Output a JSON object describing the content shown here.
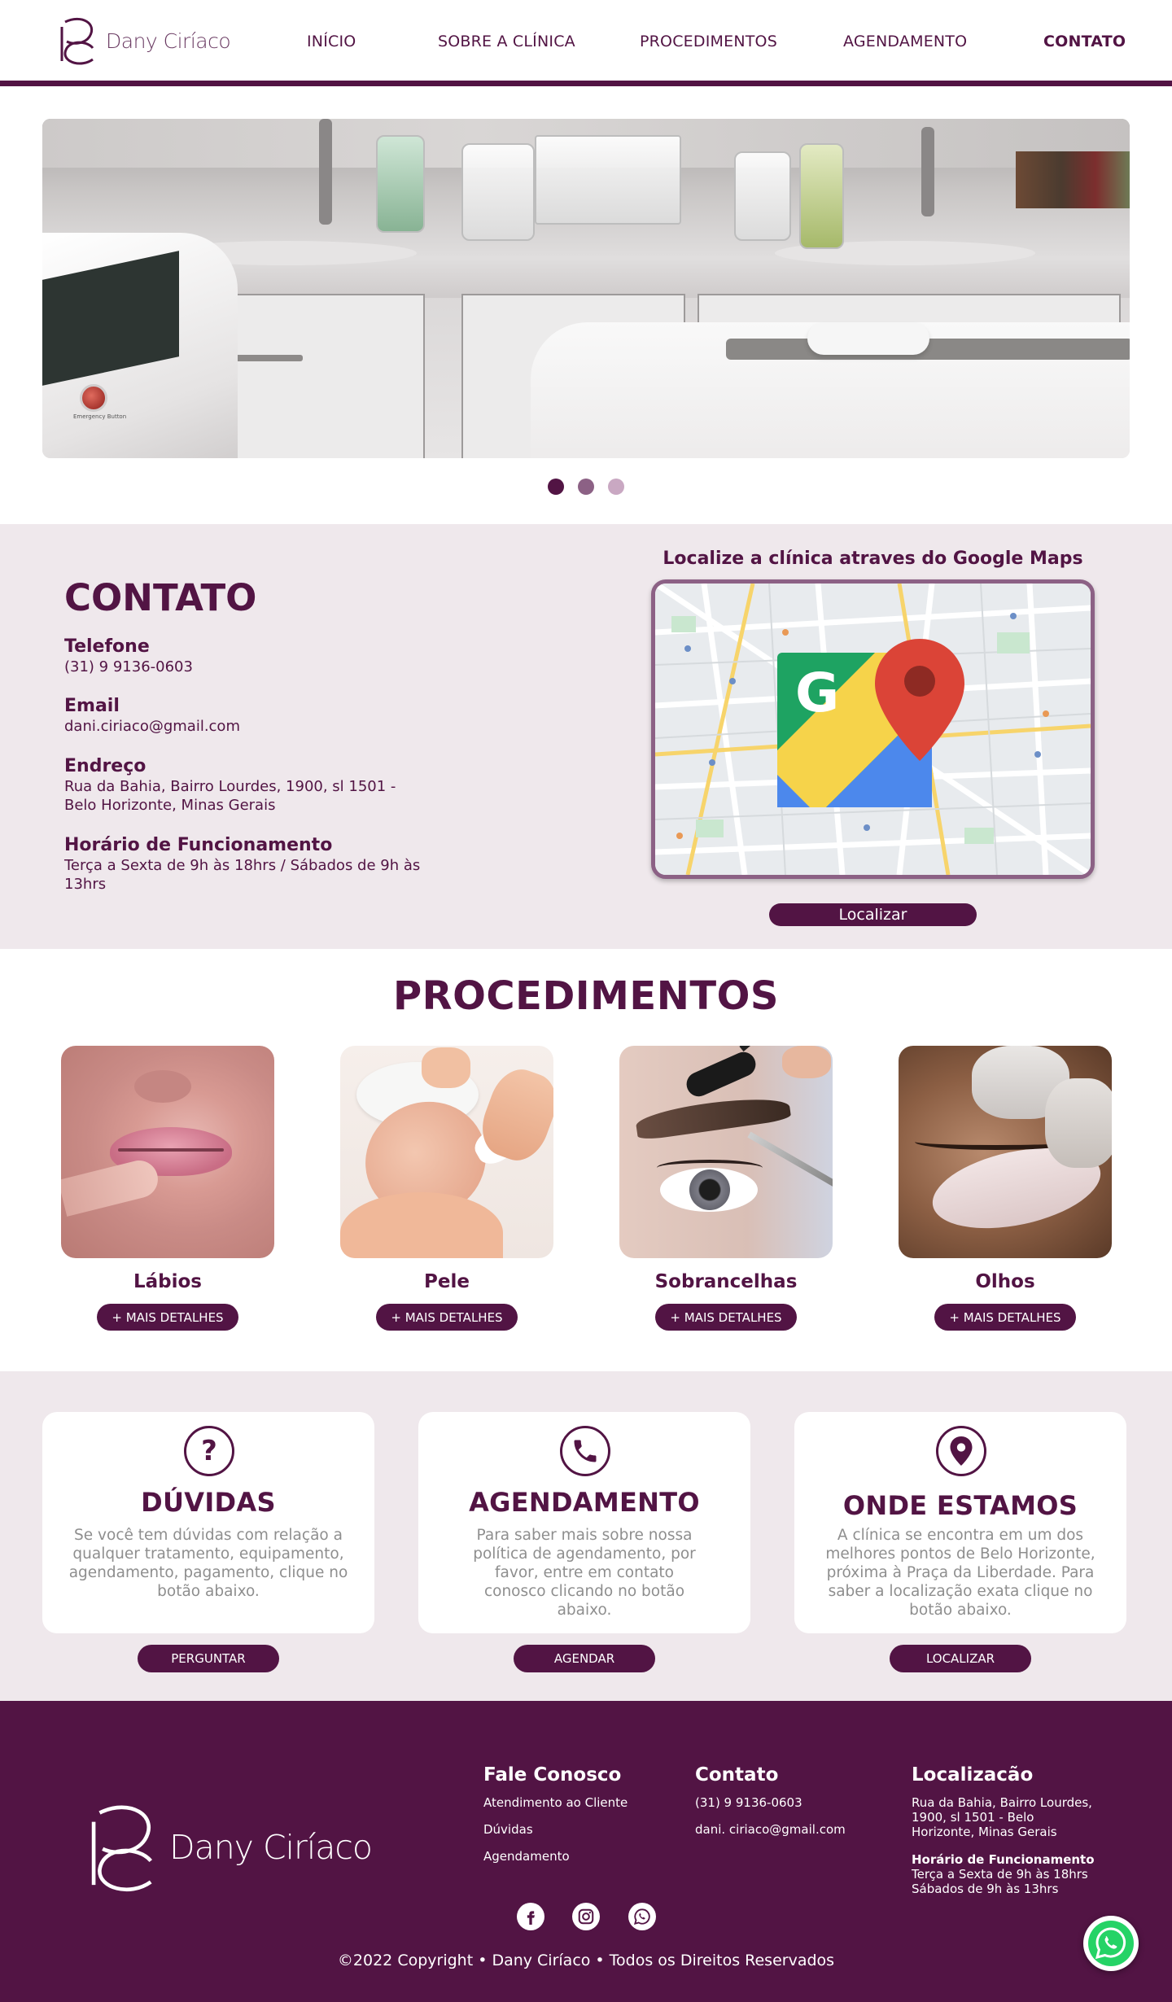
{
  "brand": {
    "name": "Dany Ciríaco"
  },
  "nav": {
    "items": [
      {
        "label": "INÍCIO"
      },
      {
        "label": "SOBRE A CLÍNICA"
      },
      {
        "label": "PROCEDIMENTOS"
      },
      {
        "label": "AGENDAMENTO"
      },
      {
        "label": "CONTATO"
      }
    ],
    "active": "CONTATO"
  },
  "hero": {
    "slides_total": 3,
    "active_slide": 1,
    "machine_label": "Emergency Button"
  },
  "contact": {
    "title": "CONTATO",
    "phone_label": "Telefone",
    "phone": "(31) 9 9136-0603",
    "email_label": "Email",
    "email": "dani.ciriaco@gmail.com",
    "address_label": "Endreço",
    "address_line1": "Rua da Bahia, Bairro Lourdes, 1900, sl 1501  -",
    "address_line2": "Belo Horizonte, Minas Gerais",
    "hours_label": "Horário de Funcionamento",
    "hours_line1": "Terça a Sexta de 9h às 18hrs / Sábados de 9h às",
    "hours_line2": "13hrs",
    "map_title": "Localize a clínica atraves do Google Maps",
    "map_button": "Localizar"
  },
  "procedures": {
    "title": "PROCEDIMENTOS",
    "button_label": "+ MAIS DETALHES",
    "items": [
      {
        "name": "Lábios"
      },
      {
        "name": "Pele"
      },
      {
        "name": "Sobrancelhas"
      },
      {
        "name": "Olhos"
      }
    ]
  },
  "info": {
    "cards": [
      {
        "title": "DÚVIDAS",
        "text": "Se você tem dúvidas com relação a qualquer tratamento, equipamento, agendamento, pagamento, clique no botão abaixo.",
        "button": "PERGUNTAR",
        "icon": "question-icon"
      },
      {
        "title": "AGENDAMENTO",
        "text": "Para saber mais sobre nossa política de agendamento, por favor, entre em contato conosco clicando no botão abaixo.",
        "button": "AGENDAR",
        "icon": "phone-icon"
      },
      {
        "title": "ONDE ESTAMOS",
        "text": "A clínica se encontra em um dos melhores pontos de Belo Horizonte, próxima à Praça da Liberdade. Para saber a localização exata clique no botão abaixo.",
        "button": "LOCALIZAR",
        "icon": "location-pin-icon"
      }
    ]
  },
  "footer": {
    "fale_title": "Fale Conosco",
    "fale_links": [
      "Atendimento ao Cliente",
      "Dúvidas",
      "Agendamento"
    ],
    "contato_title": "Contato",
    "contato_phone": "(31) 9 9136-0603",
    "contato_email": "dani. ciriaco@gmail.com",
    "local_title": "Localizacão",
    "local_line1": "Rua da Bahia, Bairro Lourdes,",
    "local_line2": "1900, sl 1501  - Belo",
    "local_line3": "Horizonte, Minas Gerais",
    "hours_title": "Horário de Funcionamento",
    "hours_line1": "Terça a Sexta de 9h às 18hrs",
    "hours_line2": "Sábados de 9h às 13hrs",
    "social": [
      "facebook-icon",
      "instagram-icon",
      "whatsapp-icon"
    ],
    "copyright": "©2022 Copyright • Dany Ciríaco • Todos os Direitos Reservados"
  },
  "colors": {
    "brand": "#521444",
    "section_bg": "#efe8ec",
    "dot_active": "#521444",
    "dot_mid": "#8c6185",
    "dot_light": "#c9a8c2",
    "whatsapp": "#25d366"
  }
}
